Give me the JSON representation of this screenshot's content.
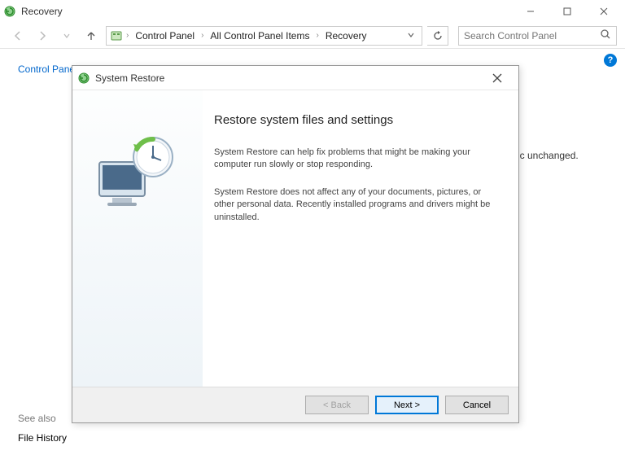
{
  "main_window": {
    "title": "Recovery",
    "breadcrumbs": {
      "item0": "Control Panel",
      "item1": "All Control Panel Items",
      "item2": "Recovery"
    },
    "search_placeholder": "Search Control Panel",
    "cp_home": "Control Panel Home",
    "bg_fragment": "ic unchanged.",
    "see_also": "See also",
    "file_history": "File History"
  },
  "dialog": {
    "title": "System Restore",
    "heading": "Restore system files and settings",
    "p1": "System Restore can help fix problems that might be making your computer run slowly or stop responding.",
    "p2": "System Restore does not affect any of your documents, pictures, or other personal data. Recently installed programs and drivers might be uninstalled.",
    "buttons": {
      "back": "< Back",
      "next": "Next >",
      "cancel": "Cancel"
    }
  }
}
